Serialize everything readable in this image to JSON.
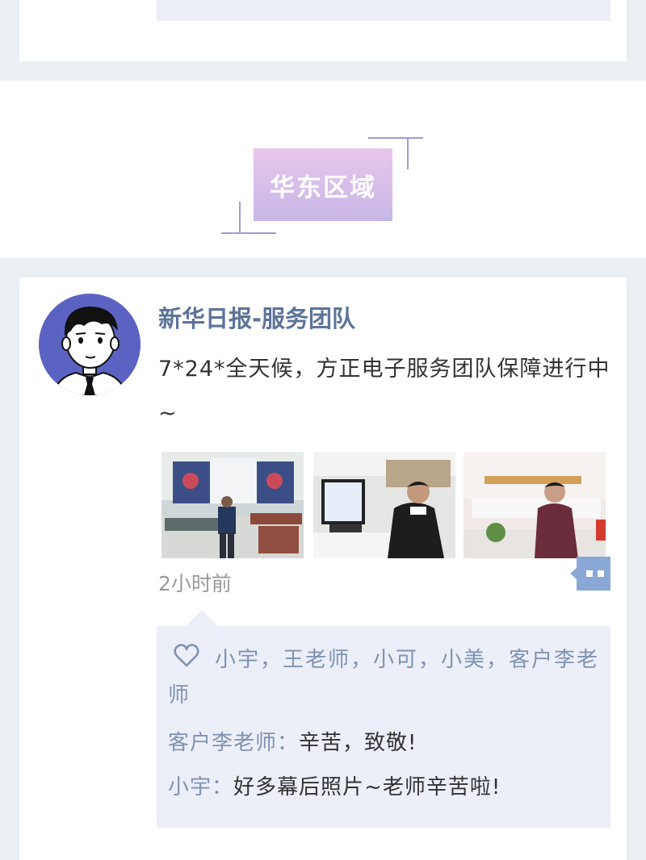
{
  "section": {
    "region": "华东区域"
  },
  "post": {
    "author": "新华日报-服务团队",
    "text": "7*24*全天候，方正电子服务团队保障进行中~",
    "time": "2小时前",
    "photos": [
      {
        "name": "command-room-photo"
      },
      {
        "name": "workstation-photo"
      },
      {
        "name": "media-center-photo"
      }
    ]
  },
  "likes": {
    "names": "小宇，王老师，小可，小美，客户李老师"
  },
  "comments": [
    {
      "author": "客户李老师",
      "sep": "：",
      "text": "辛苦，致敬!"
    },
    {
      "author": "小宇",
      "sep": "：",
      "text": "好多幕后照片~老师辛苦啦!"
    }
  ],
  "colors": {
    "author": "#5c7498",
    "like_names": "#7e93b1",
    "comment_bg": "#eceef8",
    "avatar_bg": "#5b63c2",
    "badge_gradient": [
      "#e8c6ea",
      "#c7b7e8"
    ]
  }
}
